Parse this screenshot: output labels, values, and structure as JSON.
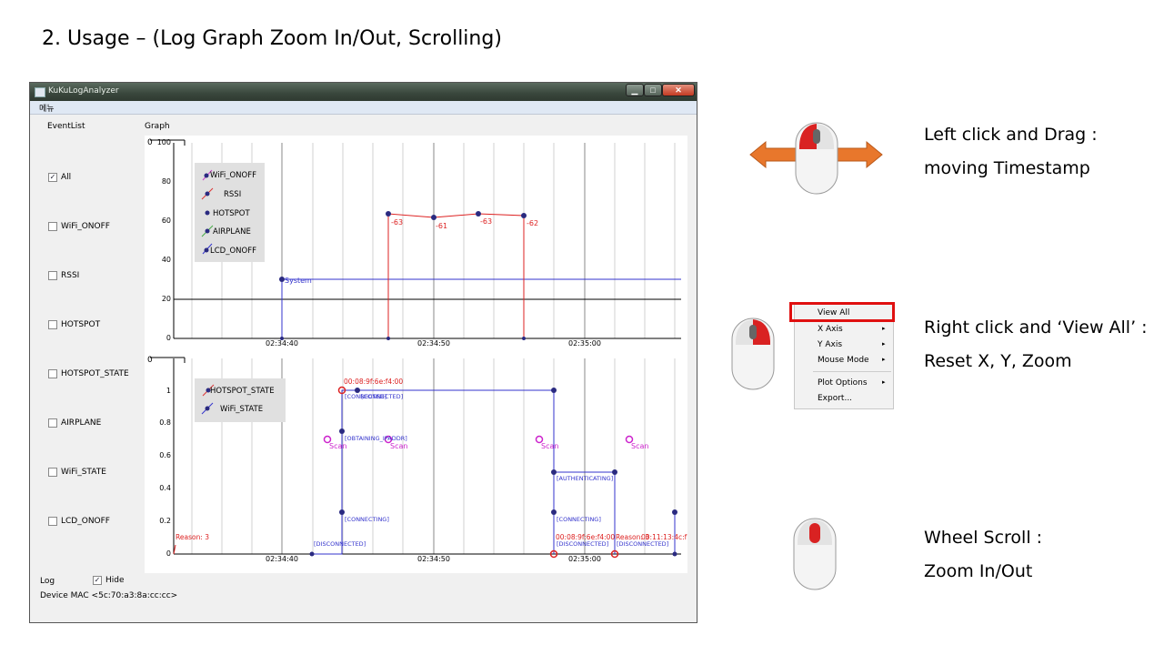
{
  "slide": {
    "title": "2. Usage – (Log Graph Zoom In/Out, Scrolling)"
  },
  "window": {
    "title": "KuKuLogAnalyzer",
    "menu": "메뉴",
    "close_glyph": "✕",
    "minimize_glyph": "▁",
    "maximize_glyph": "□"
  },
  "event_list": {
    "header": "EventList",
    "items": [
      {
        "label": "All",
        "checked": true
      },
      {
        "label": "WiFi_ONOFF",
        "checked": false
      },
      {
        "label": "RSSI",
        "checked": false
      },
      {
        "label": "HOTSPOT",
        "checked": false
      },
      {
        "label": "HOTSPOT_STATE",
        "checked": false
      },
      {
        "label": "AIRPLANE",
        "checked": false
      },
      {
        "label": "WiFi_STATE",
        "checked": false
      },
      {
        "label": "LCD_ONOFF",
        "checked": false
      }
    ],
    "check_glyph": "✓"
  },
  "graph": {
    "header": "Graph",
    "top_chart": {
      "y_ticks": [
        "100",
        "80",
        "60",
        "40",
        "20",
        "0"
      ],
      "x_ticks": [
        "02:34:40",
        "02:34:50",
        "02:35:00"
      ],
      "legend": [
        "WiFi_ONOFF",
        "RSSI",
        "HOTSPOT",
        "AIRPLANE",
        "LCD_ONOFF"
      ],
      "labels": [
        "-63",
        "-61",
        "-63",
        "-62",
        "System"
      ],
      "corner_label": "0"
    },
    "bottom_chart": {
      "y_ticks": [
        "1",
        "0.8",
        "0.6",
        "0.4",
        "0.2",
        "0"
      ],
      "x_ticks": [
        "02:34:40",
        "02:34:50",
        "02:35:00"
      ],
      "legend": [
        "HOTSPOT_STATE",
        "WiFi_STATE"
      ],
      "labels": {
        "mac1": "00:08:9f:6e:f4:00",
        "connected": "[CONNECTED]",
        "connected_overlap": "[CONNECTED]",
        "obtaining": "[OBTAINING_IPADDR]",
        "scan": "Scan",
        "connecting": "[CONNECTING]",
        "disconnected": "[DISCONNECTED]",
        "authenticating": "[AUTHENTICATING]",
        "reason": "Reason: 3",
        "mac2": "00:08:9f:6e:f4:00",
        "reason2": "Reason: 3",
        "mac3": "00:11:13:4c:f"
      },
      "corner_label": "0"
    }
  },
  "status": {
    "log_label": "Log",
    "hide_label": "Hide",
    "hide_checked": true,
    "device_mac": "Device MAC <5c:70:a3:8a:cc:cc>"
  },
  "instructions": {
    "drag_line1": "Left click and Drag :",
    "drag_line2": "moving Timestamp",
    "viewall_line1": "Right click and ‘View All’ :",
    "viewall_line2": "Reset X, Y, Zoom",
    "wheel_line1": "Wheel Scroll :",
    "wheel_line2": "Zoom In/Out"
  },
  "context_menu": {
    "items": [
      {
        "label": "View All",
        "submenu": false
      },
      {
        "label": "X Axis",
        "submenu": true
      },
      {
        "label": "Y Axis",
        "submenu": true
      },
      {
        "label": "Mouse Mode",
        "submenu": true
      },
      {
        "label": "Plot Options",
        "submenu": true
      },
      {
        "label": "Export...",
        "submenu": false
      }
    ],
    "arrow_glyph": "▸"
  },
  "colors": {
    "accent_red": "#e01010",
    "series_blue": "#3333cc",
    "series_red": "#dd2222",
    "scan_magenta": "#cc22cc",
    "arrow_orange": "#e8772c"
  }
}
